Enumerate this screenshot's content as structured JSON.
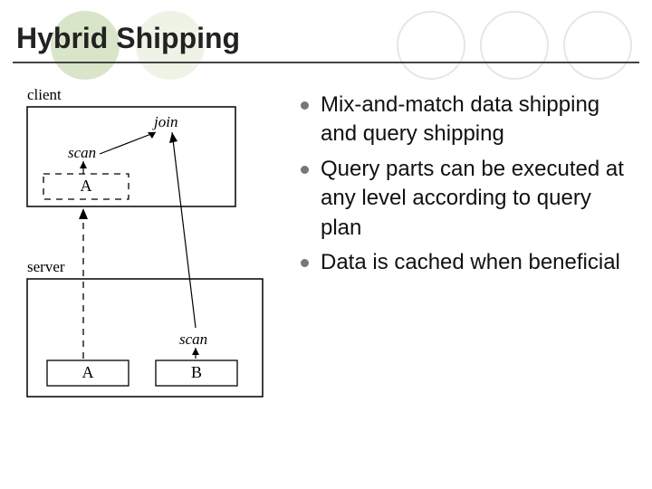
{
  "title": "Hybrid Shipping",
  "diagram": {
    "client_label": "client",
    "server_label": "server",
    "join_label": "join",
    "scan_top": "scan",
    "scan_bottom": "scan",
    "A_cached": "A",
    "A_source": "A",
    "B_source": "B"
  },
  "bullets": [
    "Mix-and-match data shipping and query shipping",
    "Query parts can be executed at any level according to query plan",
    "Data is cached when beneficial"
  ]
}
